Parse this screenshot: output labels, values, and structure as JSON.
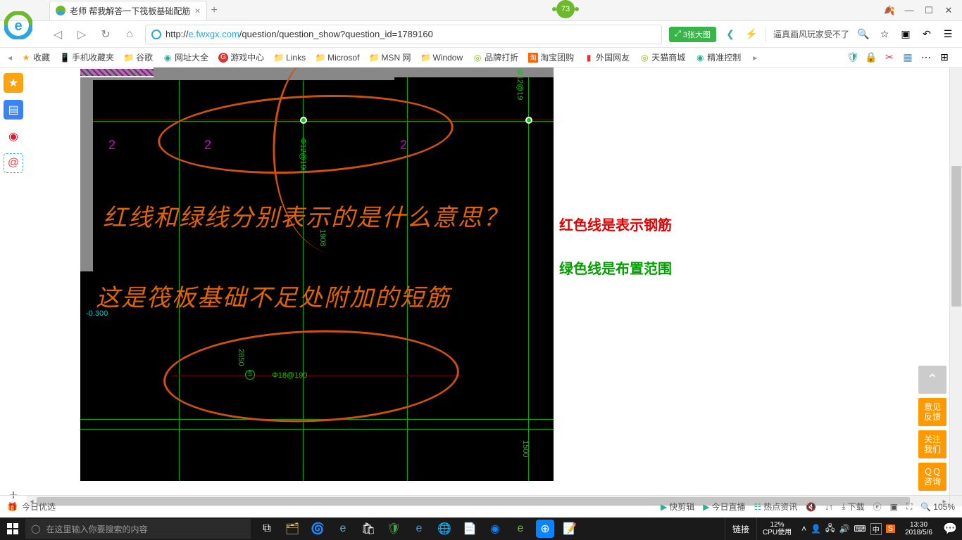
{
  "tab": {
    "title": "老师 帮我解答一下筏板基础配筋"
  },
  "score": "73",
  "window": {
    "leaf": "🍂",
    "min": "—",
    "max": "☐",
    "close": "✕"
  },
  "nav": {
    "back": "◁",
    "forward": "▷",
    "reload": "↻",
    "home": "⌂"
  },
  "url": {
    "prefix": "http://",
    "host": "e.fwxgx.com",
    "path": "/question/question_show?question_id=1789160"
  },
  "pic_btn": "3张大图",
  "share": "❮",
  "bolt": "⚡",
  "slogan": "逼真画风玩家受不了",
  "addr_icons": {
    "search": "🔍",
    "star": "☆",
    "panel": "▣",
    "undo": "↶",
    "menu": "☰"
  },
  "bookmarks": {
    "fav": "收藏",
    "phone": "手机收藏夹",
    "google": "谷歌",
    "daquan": "网址大全",
    "game": "游戏中心",
    "links": "Links",
    "ms": "Microsof",
    "msn": "MSN 网",
    "window": "Window",
    "brand": "品牌打折",
    "tao": "淘宝团购",
    "guowai": "外国网友",
    "tmall": "天猫商城",
    "jing": "精准控制"
  },
  "bookbar_right": {
    "shield": "🛡",
    "lock": "🔒",
    "scissors": "✂",
    "grid": "▦",
    "dots": "⋯"
  },
  "content": {
    "annot1": "红线和绿线分别表示的是什么意思？",
    "annot2": "这是筏板基础不足处附加的短筋",
    "red_note": "红色线是表示钢筋",
    "green_note": "绿色线是布置范围",
    "dims": {
      "a": "Φ12@190",
      "b": "1908",
      "c": "Φ18@190",
      "d": "2850",
      "e": "1500",
      "f": "-0.300",
      "g": "Φ12@19"
    },
    "mark2": "2"
  },
  "float": {
    "top": "⌃",
    "feedback": "意见\n反馈",
    "follow": "关注\n我们",
    "qq": "ＱＱ\n咨询"
  },
  "status": {
    "today": "今日优选",
    "cut": "快剪辑",
    "live": "今日直播",
    "hot": "热点资讯",
    "mute": "🔇",
    "net": "↓↑",
    "dl": "下载",
    "pip": "ⓔ",
    "page": "▣",
    "zoom_icon": "🔍",
    "zoom": "105%"
  },
  "taskbar": {
    "search_ph": "在这里输入你要搜索的内容",
    "links": "链接",
    "cpu_pct": "12%",
    "cpu_lbl": "CPU使用",
    "ime": "中",
    "sogou": "S",
    "time": "13:30",
    "date": "2018/5/6"
  }
}
